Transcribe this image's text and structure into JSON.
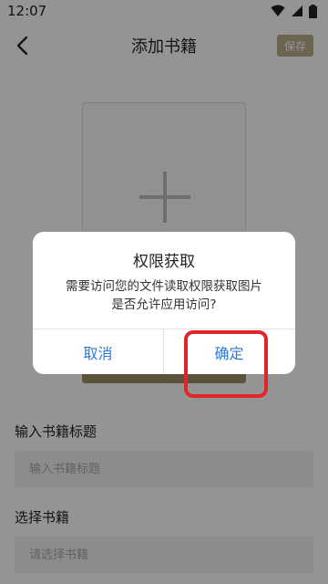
{
  "status_bar": {
    "time": "12:07"
  },
  "header": {
    "title": "添加书籍",
    "save_label": "保存"
  },
  "form": {
    "title_label": "输入书籍标题",
    "title_placeholder": "输入书籍标题",
    "book_label": "选择书籍",
    "book_placeholder": "请选择书籍"
  },
  "dialog": {
    "title": "权限获取",
    "message_line1": "需要访问您的文件读取权限获取图片",
    "message_line2": "是否允许应用访问?",
    "cancel_label": "取消",
    "confirm_label": "确定"
  },
  "colors": {
    "accent": "#9e8d66",
    "dialog_button": "#2979d8",
    "highlight": "#e0262b"
  },
  "icons": [
    "back-arrow-icon",
    "wifi-icon",
    "signal-icon",
    "battery-icon",
    "plus-icon"
  ]
}
